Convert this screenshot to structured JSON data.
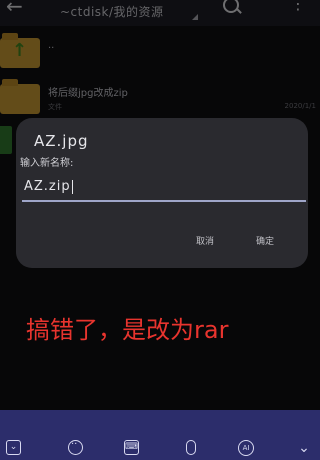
{
  "topbar": {
    "path": "~ctdisk/我的资源"
  },
  "rows": [
    {
      "title": "..",
      "subtitle": "",
      "date": ""
    },
    {
      "title": "将后缀jpg改成zip",
      "subtitle": "文件",
      "date": "2020/1/1"
    }
  ],
  "dialog": {
    "file_name": "AZ.jpg",
    "prompt": "输入新名称:",
    "input_value": "AZ.zip",
    "cancel_label": "取消",
    "ok_label": "确定"
  },
  "annotation": "搞错了，是改为rar",
  "keyboard": {
    "icons": [
      "keyboard-collapse-icon",
      "emoji-icon",
      "keyboard-icon",
      "microphone-icon",
      "ai-icon",
      "chevron-down-icon"
    ],
    "ai_label": "AI"
  },
  "colors": {
    "annotation": "#e8342e",
    "keyboard_bar": "#2c2d6b",
    "dialog_bg": "#2a2a2f",
    "folder": "#b58a2e",
    "input_underline": "#9fa6c9"
  }
}
